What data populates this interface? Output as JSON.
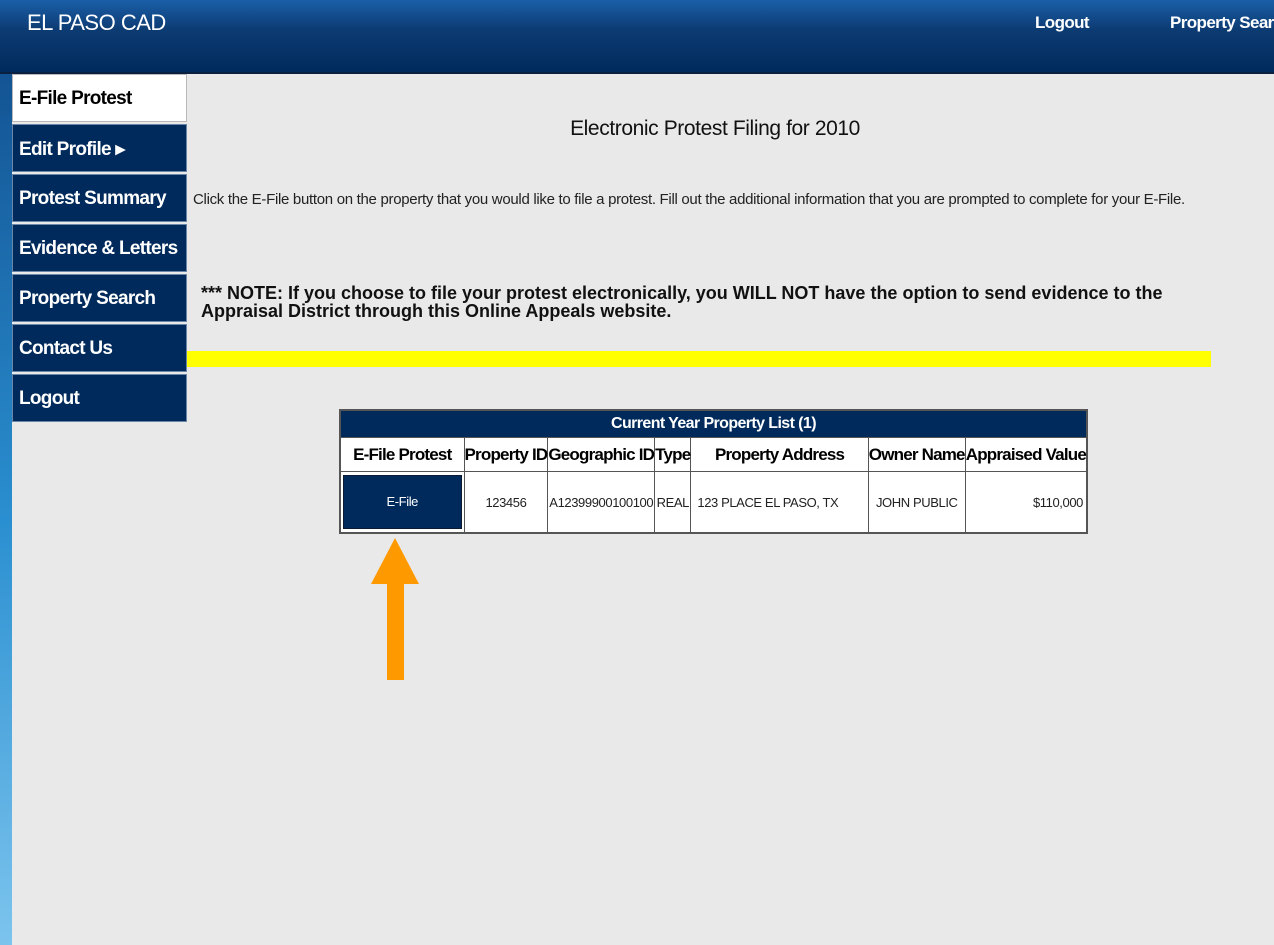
{
  "header": {
    "brand": "EL PASO CAD",
    "logout": "Logout",
    "property_search": "Property Searc"
  },
  "sidebar": {
    "items": [
      {
        "label": "E-File Protest",
        "active": true
      },
      {
        "label": "Edit Profile ▸",
        "active": false
      },
      {
        "label": "Protest Summary",
        "active": false
      },
      {
        "label": "Evidence & Letters",
        "active": false
      },
      {
        "label": "Property Search",
        "active": false
      },
      {
        "label": "Contact Us",
        "active": false
      },
      {
        "label": "Logout",
        "active": false
      }
    ]
  },
  "main": {
    "title": "Electronic Protest Filing for 2010",
    "instructions": "Click the E-File button on the property that you would like to file a protest. Fill out the additional information that you are prompted to complete for your E-File.",
    "note": "*** NOTE: If you choose to file your protest electronically, you WILL NOT have the option to send evidence to the Appraisal District through this Online Appeals website."
  },
  "table": {
    "caption": "Current Year Property List (1)",
    "headers": [
      "E-File Protest",
      "Property ID",
      "Geographic ID",
      "Type",
      "Property Address",
      "Owner Name",
      "Appraised Value"
    ],
    "rows": [
      {
        "button": "E-File",
        "property_id": "123456",
        "geographic_id": "A12399900100100",
        "type": "REAL",
        "address": "123 PLACE EL PASO, TX",
        "owner": "JOHN PUBLIC",
        "value": "$110,000"
      }
    ]
  },
  "colors": {
    "navy": "#002a5c",
    "highlight": "#ffff00",
    "arrow": "#ff9900",
    "background": "#e9e9e9"
  }
}
